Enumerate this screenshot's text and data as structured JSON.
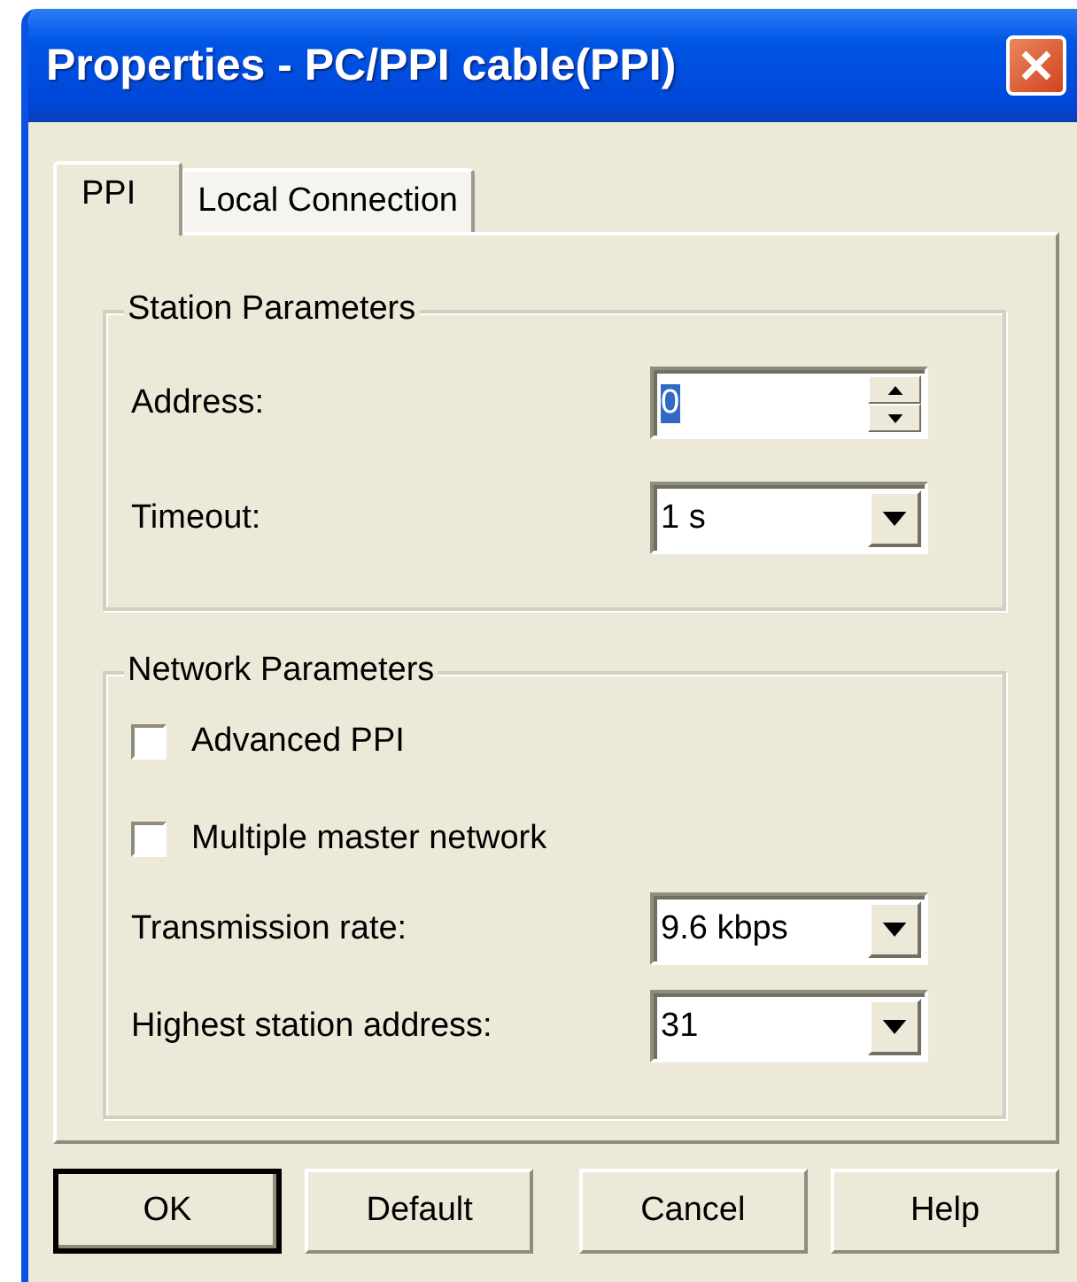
{
  "window": {
    "title": "Properties - PC/PPI cable(PPI)"
  },
  "tabs": [
    {
      "label": "PPI",
      "selected": true
    },
    {
      "label": "Local Connection",
      "selected": false
    }
  ],
  "groups": [
    {
      "title": "Station Parameters",
      "rows": [
        {
          "kind": "spin",
          "label": "Address:",
          "value": "0",
          "highlighted": true
        },
        {
          "kind": "dropdown",
          "label": "Timeout:",
          "value": "1 s"
        }
      ]
    },
    {
      "title": "Network Parameters",
      "rows": [
        {
          "kind": "checkbox",
          "label": "Advanced PPI",
          "checked": false
        },
        {
          "kind": "checkbox",
          "label": "Multiple master network",
          "checked": false
        },
        {
          "kind": "dropdown",
          "label": "Transmission rate:",
          "value": "9.6 kbps"
        },
        {
          "kind": "dropdown",
          "label": "Highest station address:",
          "value": "31"
        }
      ]
    }
  ],
  "buttons": [
    {
      "label": "OK",
      "default": true
    },
    {
      "label": "Default",
      "default": false
    },
    {
      "label": "Cancel",
      "default": false
    },
    {
      "label": "Help",
      "default": false
    }
  ]
}
